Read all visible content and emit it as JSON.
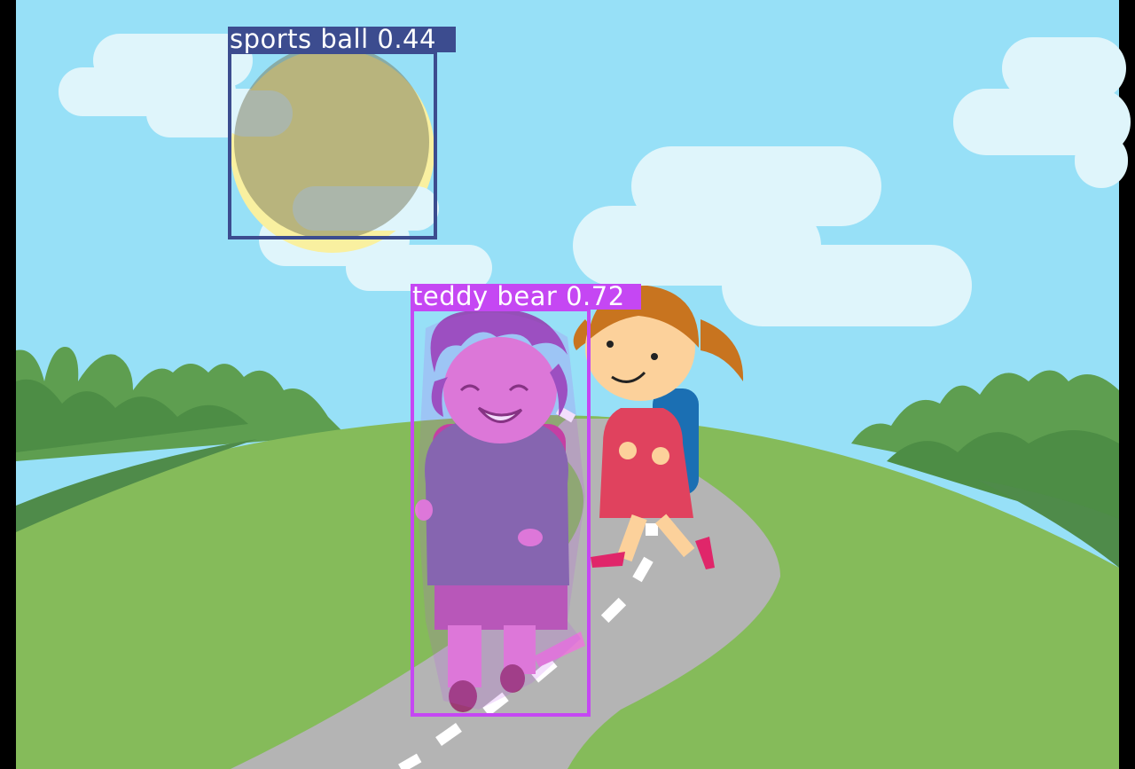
{
  "colors": {
    "sky": "#97E0F7",
    "cloud": "#DFF5FB",
    "hill": "#85BB5A",
    "hill_dark": "#4F8B4A",
    "road": "#B4B4B4",
    "road_mark": "#FFFFFF",
    "frame": "#000000",
    "sports_ball_box": "#3C4C8F",
    "teddy_bear_box": "#C547F3"
  },
  "detections": [
    {
      "id": "sports-ball",
      "label": "sports ball 0.44",
      "class_name": "sports ball",
      "confidence": 0.44,
      "color": "#3C4C8F",
      "mask_color": "rgba(120,120,110,0.55)"
    },
    {
      "id": "teddy-bear",
      "label": "teddy bear 0.72",
      "class_name": "teddy bear",
      "confidence": 0.72,
      "color": "#C547F3",
      "mask_color": "rgba(190,80,240,0.5)"
    }
  ]
}
